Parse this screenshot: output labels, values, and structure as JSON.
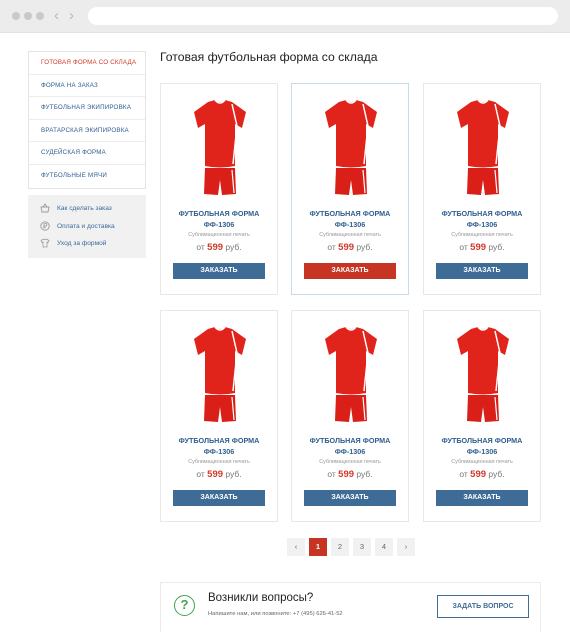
{
  "sidebar": {
    "items": [
      {
        "label": "Готовая форма со склада"
      },
      {
        "label": "Форма на заказ"
      },
      {
        "label": "Футбольная экипировка"
      },
      {
        "label": "Вратарская экипировка"
      },
      {
        "label": "Судейская форма"
      },
      {
        "label": "Футбольные мячи"
      }
    ]
  },
  "help": {
    "items": [
      {
        "label": "Как сделать заказ",
        "icon": "basket-icon"
      },
      {
        "label": "Оплата и доставка",
        "icon": "ruble-coin-icon"
      },
      {
        "label": "Уход за формой",
        "icon": "shirt-icon"
      }
    ]
  },
  "page": {
    "title": "Готовая футбольная форма со склада"
  },
  "products": [
    {
      "name_line1": "ФУТБОЛЬНАЯ ФОРМА",
      "name_line2": "ФФ-1306",
      "desc": "Сублимационная печать",
      "price_prefix": "от",
      "price": "599",
      "currency": "руб.",
      "button": "ЗАКАЗАТЬ"
    },
    {
      "name_line1": "ФУТБОЛЬНАЯ ФОРМА",
      "name_line2": "ФФ-1306",
      "desc": "Сублимационная печать",
      "price_prefix": "от",
      "price": "599",
      "currency": "руб.",
      "button": "ЗАКАЗАТЬ"
    },
    {
      "name_line1": "ФУТБОЛЬНАЯ ФОРМА",
      "name_line2": "ФФ-1306",
      "desc": "Сублимационная печать",
      "price_prefix": "от",
      "price": "599",
      "currency": "руб.",
      "button": "ЗАКАЗАТЬ"
    },
    {
      "name_line1": "ФУТБОЛЬНАЯ ФОРМА",
      "name_line2": "ФФ-1306",
      "desc": "Сублимационная печать",
      "price_prefix": "от",
      "price": "599",
      "currency": "руб.",
      "button": "ЗАКАЗАТЬ"
    },
    {
      "name_line1": "ФУТБОЛЬНАЯ ФОРМА",
      "name_line2": "ФФ-1306",
      "desc": "Сублимационная печать",
      "price_prefix": "от",
      "price": "599",
      "currency": "руб.",
      "button": "ЗАКАЗАТЬ"
    },
    {
      "name_line1": "ФУТБОЛЬНАЯ ФОРМА",
      "name_line2": "ФФ-1306",
      "desc": "Сублимационная печать",
      "price_prefix": "от",
      "price": "599",
      "currency": "руб.",
      "button": "ЗАКАЗАТЬ"
    }
  ],
  "pagination": {
    "prev": "‹",
    "pages": [
      "1",
      "2",
      "3",
      "4"
    ],
    "current": "1",
    "next": "›"
  },
  "questions": {
    "icon": "?",
    "title": "Возникли вопросы?",
    "subtitle": "Напишите нам, или позвоните: +7 (495) 626-41-52",
    "button": "ЗАДАТЬ ВОПРОС"
  },
  "colors": {
    "accent_red": "#c63424",
    "link_blue": "#2f5e8f",
    "button_blue": "#3f6c97",
    "green": "#3fa34d"
  }
}
